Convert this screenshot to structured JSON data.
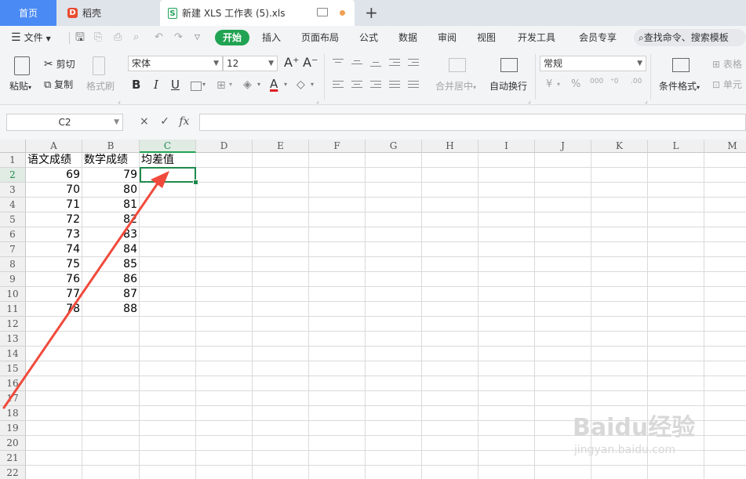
{
  "titlebar": {
    "tab_home": "首页",
    "tab_daoke": "稻壳",
    "tab_doc": "新建 XLS 工作表 (5).xls",
    "new_tab": "+"
  },
  "menubar": {
    "file": "文件",
    "items": [
      "开始",
      "插入",
      "页面布局",
      "公式",
      "数据",
      "审阅",
      "视图",
      "开发工具",
      "会员专享"
    ],
    "search": "查找命令、搜索模板"
  },
  "ribbon": {
    "paste": "粘贴",
    "cut": "剪切",
    "copy": "复制",
    "format_painter": "格式刷",
    "font_name": "宋体",
    "font_size": "12",
    "merge_center": "合并居中",
    "auto_wrap": "自动换行",
    "number_format": "常规",
    "conditional_format": "条件格式",
    "table_style": "表格",
    "cell": "单元",
    "bold": "B",
    "italic": "I",
    "underline": "U",
    "grow_font": "A⁺",
    "shrink_font": "A⁻",
    "currency": "¥",
    "percent": "%",
    "thousands": "000"
  },
  "formulabar": {
    "name_box": "C2",
    "cancel": "×",
    "confirm": "✓",
    "fx": "fx",
    "formula": ""
  },
  "sheet": {
    "columns": [
      "A",
      "B",
      "C",
      "D",
      "E",
      "F",
      "G",
      "H",
      "I",
      "J",
      "K",
      "L",
      "M"
    ],
    "rows": [
      "1",
      "2",
      "3",
      "4",
      "5",
      "6",
      "7",
      "8",
      "9",
      "10",
      "11",
      "12",
      "13",
      "14",
      "15",
      "16",
      "17",
      "18",
      "19",
      "20",
      "21",
      "22"
    ],
    "header_a": "语文成绩",
    "header_b": "数学成绩",
    "header_c": "均差值",
    "col_a": [
      "69",
      "70",
      "71",
      "72",
      "73",
      "74",
      "75",
      "76",
      "77",
      "78"
    ],
    "col_b": [
      "79",
      "80",
      "81",
      "82",
      "83",
      "84",
      "85",
      "86",
      "87",
      "88"
    ],
    "active_cell": "C2"
  },
  "annotation": {
    "color": "#f04a3c"
  },
  "watermark": {
    "main": "Baidu经验",
    "sub": "jingyan.baidu.com"
  }
}
